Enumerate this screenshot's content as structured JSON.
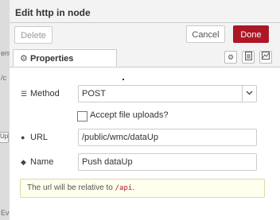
{
  "backdrop": {
    "text1": "ent",
    "text2": "/c",
    "text3": "Up",
    "text4": "Ev"
  },
  "dialog": {
    "title": "Edit http in node"
  },
  "toolbar": {
    "delete_label": "Delete",
    "cancel_label": "Cancel",
    "done_label": "Done"
  },
  "tabs": {
    "properties_label": "Properties"
  },
  "form": {
    "method_label": "Method",
    "method_value": "POST",
    "accept_uploads_label": "Accept file uploads?",
    "url_label": "URL",
    "url_value": "/public/wmc/dataUp",
    "name_label": "Name",
    "name_value": "Push dataUp",
    "tip_prefix": "The url will be relative to ",
    "tip_code": "/api",
    "tip_suffix": "."
  },
  "colors": {
    "done_button": "#ad1625",
    "tip_background": "#ffffee"
  }
}
